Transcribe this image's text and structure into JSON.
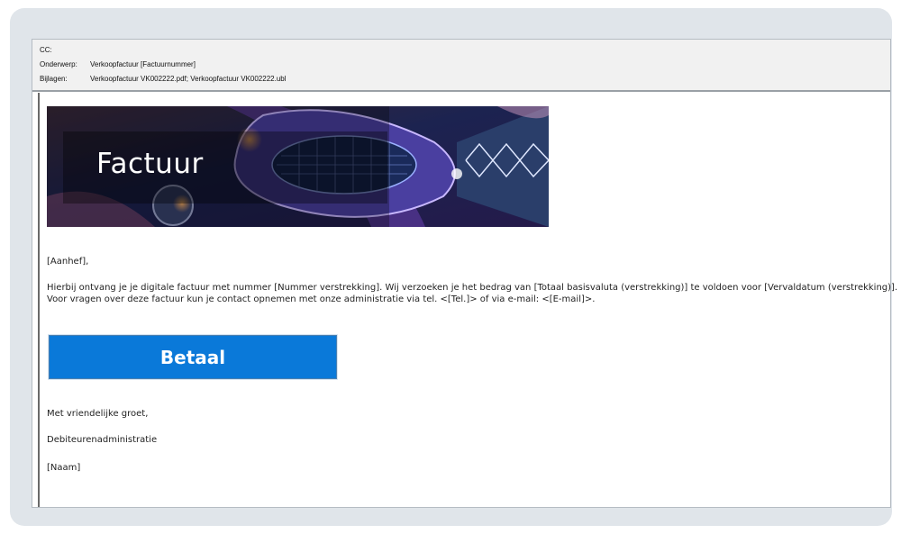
{
  "header": {
    "cc_label": "CC:",
    "cc_value": "",
    "subject_label": "Onderwerp:",
    "subject_value": "Verkoopfactuur [Factuurnummer]",
    "attachments_label": "Bijlagen:",
    "attachments_value": "Verkoopfactuur VK002222.pdf; Verkoopfactuur VK002222.ubl"
  },
  "banner": {
    "title": "Factuur"
  },
  "message": {
    "salutation": "[Aanhef],",
    "paragraph_line1": "Hierbij ontvang je je digitale factuur met nummer [Nummer verstrekking]. Wij verzoeken je het bedrag van [Totaal basisvaluta (verstrekking)] te voldoen voor [Vervaldatum (verstrekking)].",
    "paragraph_line2": "Voor vragen over deze factuur kun je contact opnemen met onze administratie via tel. <[Tel.]> of via e-mail: <[E-mail]>.",
    "pay_button": "Betaal",
    "closing": "Met vriendelijke groet,",
    "department": "Debiteurenadministratie",
    "name": "[Naam]"
  },
  "colors": {
    "pay_button": "#0a79d9",
    "frame": "#e0e5ea"
  }
}
